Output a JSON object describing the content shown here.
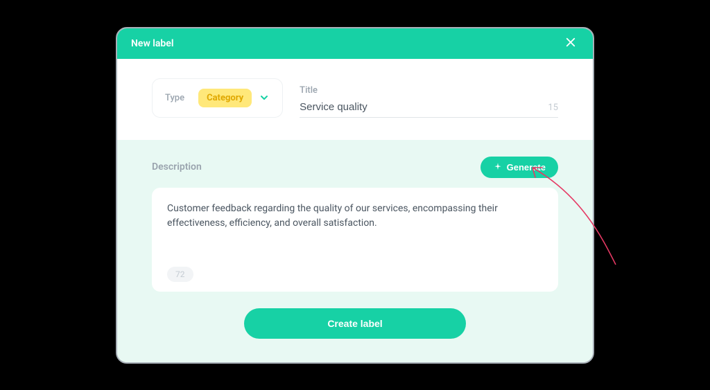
{
  "header": {
    "title": "New label"
  },
  "type": {
    "label": "Type",
    "selected": "Category"
  },
  "title_field": {
    "label": "Title",
    "value": "Service quality",
    "count": "15"
  },
  "description": {
    "label": "Description",
    "generate_label": "Generate",
    "value": "Customer feedback regarding the quality of our services, encompassing their effectiveness, efficiency, and overall satisfaction.",
    "count": "72"
  },
  "footer": {
    "create_label": "Create label"
  }
}
